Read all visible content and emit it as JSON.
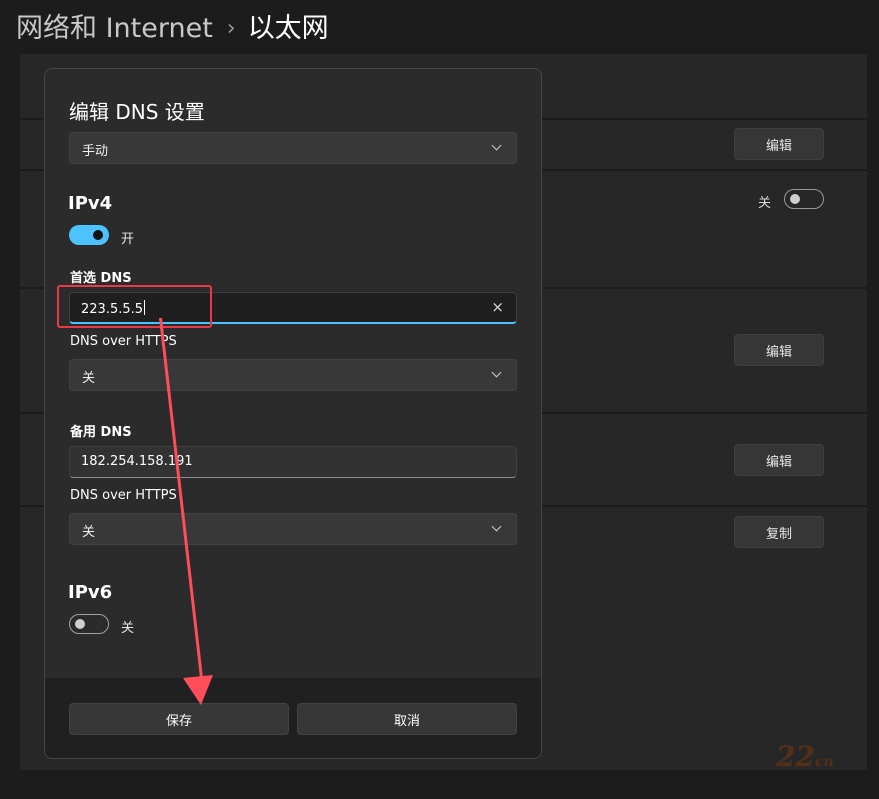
{
  "breadcrumb": {
    "parent": "网络和 Internet",
    "separator": "›",
    "current": "以太网"
  },
  "background": {
    "edit_buttons": [
      "编辑",
      "编辑",
      "编辑"
    ],
    "copy_button": "复制",
    "toggle_label": "关"
  },
  "dialog": {
    "title": "编辑 DNS 设置",
    "mode_select": "手动",
    "ipv4": {
      "heading": "IPv4",
      "toggle_label": "开",
      "preferred_dns_label": "首选 DNS",
      "preferred_dns_value": "223.5.5.5",
      "doh_label_1": "DNS over HTTPS",
      "doh_value_1": "关",
      "alternate_dns_label": "备用 DNS",
      "alternate_dns_value": "182.254.158.191",
      "doh_label_2": "DNS over HTTPS",
      "doh_value_2": "关"
    },
    "ipv6": {
      "heading": "IPv6",
      "toggle_label": "关"
    },
    "save_button": "保存",
    "cancel_button": "取消",
    "clear_icon": "×"
  },
  "watermark": {
    "number": "22",
    "suffix": "cn"
  },
  "colors": {
    "accent": "#4cc2ff",
    "annotation": "#ff4d5a"
  }
}
